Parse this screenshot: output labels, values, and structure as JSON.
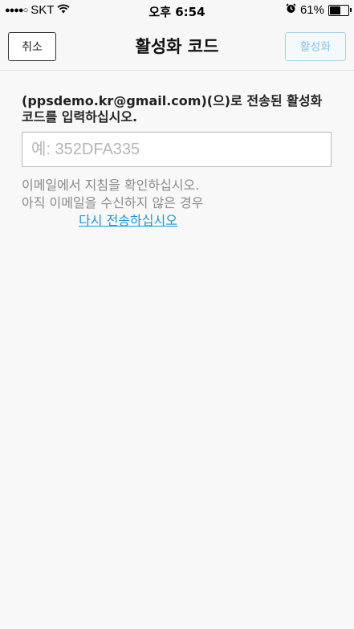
{
  "status_bar": {
    "carrier": "SKT",
    "signal_dots": "●●●●○",
    "time": "오후 6:54",
    "battery_percent": "61%",
    "battery_level": 0.61,
    "icons": [
      "signal-dots-icon",
      "wifi-icon",
      "alarm-clock-icon",
      "battery-icon"
    ]
  },
  "navbar": {
    "cancel_label": "취소",
    "title": "활성화 코드",
    "activate_label": "활성화"
  },
  "form": {
    "instruction": "(ppsdemo.kr@gmail.com)(으)로 전송된 활성화 코드를 입력하십시오.",
    "code_placeholder": "예: 352DFA335",
    "code_value": "",
    "hint_line1": "이메일에서 지침을 확인하십시오.",
    "hint_line2": "아직 이메일을 수신하지 않은 경우",
    "resend_link": "다시 전송하십시오"
  },
  "colors": {
    "background": "#f8f8f8",
    "link": "#1c9ad6",
    "disabled_button_text": "#8fc3e3",
    "disabled_button_border": "#a9d3ec"
  }
}
